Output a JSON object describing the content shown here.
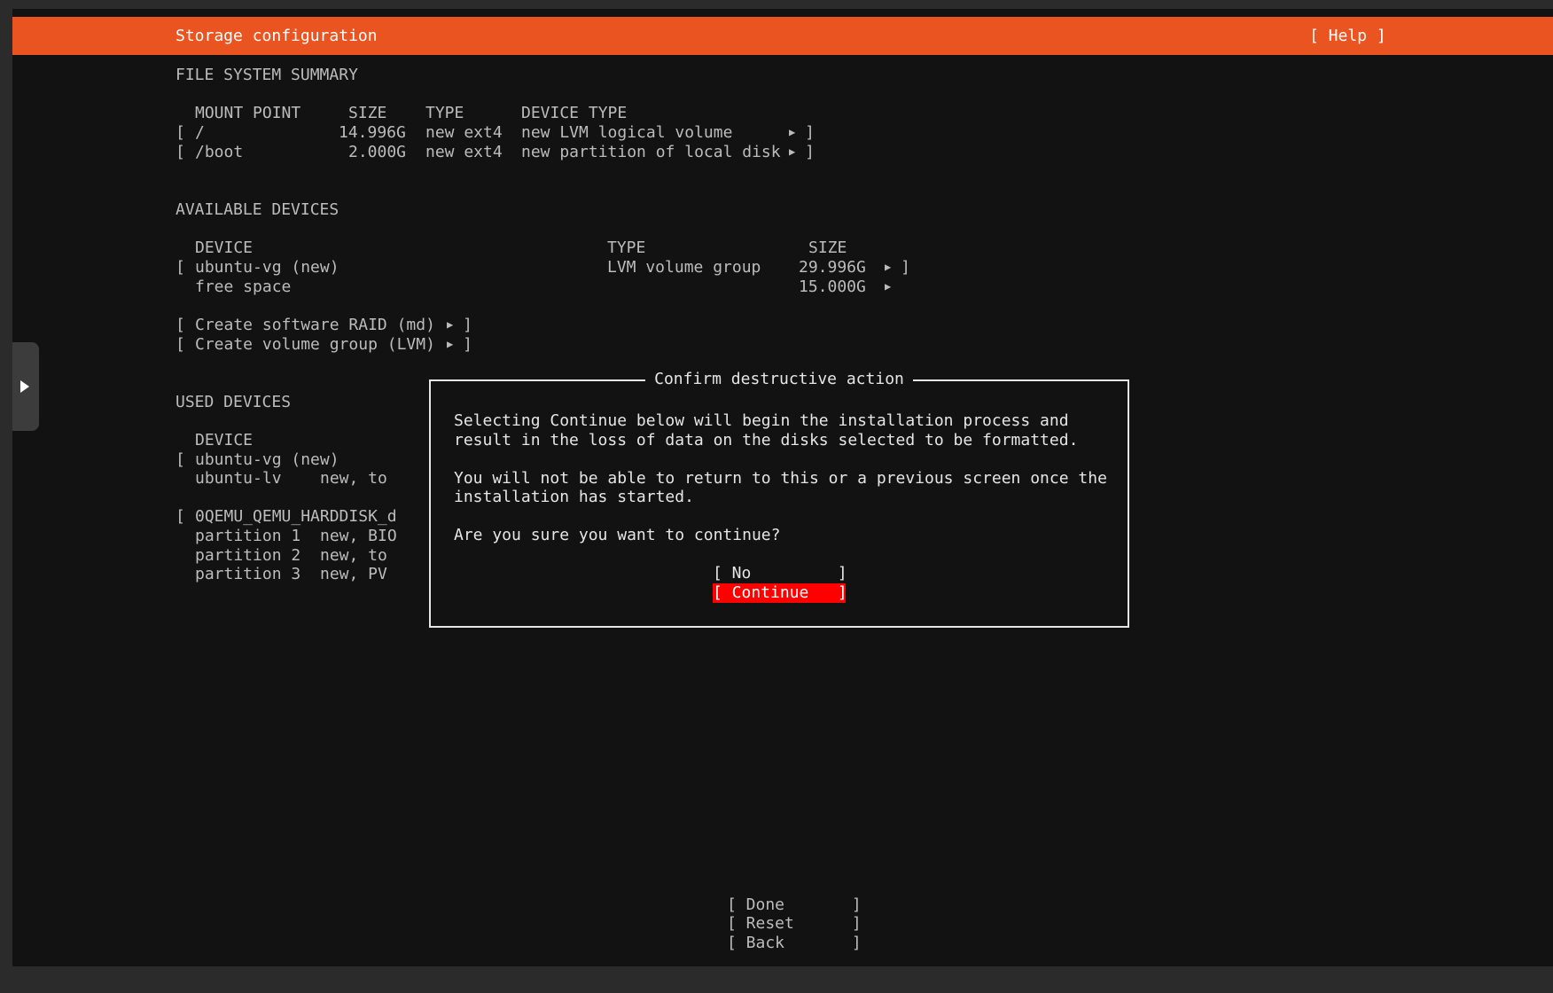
{
  "header": {
    "title": "Storage configuration",
    "help_label": "[ Help ]",
    "bar_color": "#e95420"
  },
  "fs_summary": {
    "heading": "FILE SYSTEM SUMMARY",
    "columns": [
      "MOUNT POINT",
      "SIZE",
      "TYPE",
      "DEVICE TYPE"
    ],
    "rows": [
      {
        "mount": "/",
        "size": "14.996G",
        "type": "new ext4",
        "device_type": "new LVM logical volume"
      },
      {
        "mount": "/boot",
        "size": "2.000G",
        "type": "new ext4",
        "device_type": "new partition of local disk"
      }
    ]
  },
  "available_devices": {
    "heading": "AVAILABLE DEVICES",
    "columns": [
      "DEVICE",
      "TYPE",
      "SIZE"
    ],
    "rows": [
      {
        "device": "ubuntu-vg (new)",
        "type": "LVM volume group",
        "size": "29.996G"
      },
      {
        "device": "free space",
        "type": "",
        "size": "15.000G"
      }
    ],
    "actions": [
      "Create software RAID (md)",
      "Create volume group (LVM)"
    ]
  },
  "used_devices": {
    "heading": "USED DEVICES",
    "column": "DEVICE",
    "rows": [
      {
        "device": "ubuntu-vg (new)",
        "detail": ""
      },
      {
        "device": "ubuntu-lv",
        "detail": "new, to"
      },
      {
        "device": "0QEMU_QEMU_HARDDISK_d",
        "detail": ""
      },
      {
        "device": "partition 1",
        "detail": "new, BIO"
      },
      {
        "device": "partition 2",
        "detail": "new, to"
      },
      {
        "device": "partition 3",
        "detail": "new, PV"
      }
    ]
  },
  "dialog": {
    "title": "Confirm destructive action",
    "line1": "Selecting Continue below will begin the installation process and",
    "line2": "result in the loss of data on the disks selected to be formatted.",
    "line3": "You will not be able to return to this or a previous screen once the",
    "line4": "installation has started.",
    "question": "Are you sure you want to continue?",
    "no_label": "[ No         ]",
    "continue_label": "[ Continue   ]",
    "focus_color": "#ff0000"
  },
  "footer": {
    "done_label": "[ Done       ]",
    "reset_label": "[ Reset      ]",
    "back_label": "[ Back       ]"
  }
}
